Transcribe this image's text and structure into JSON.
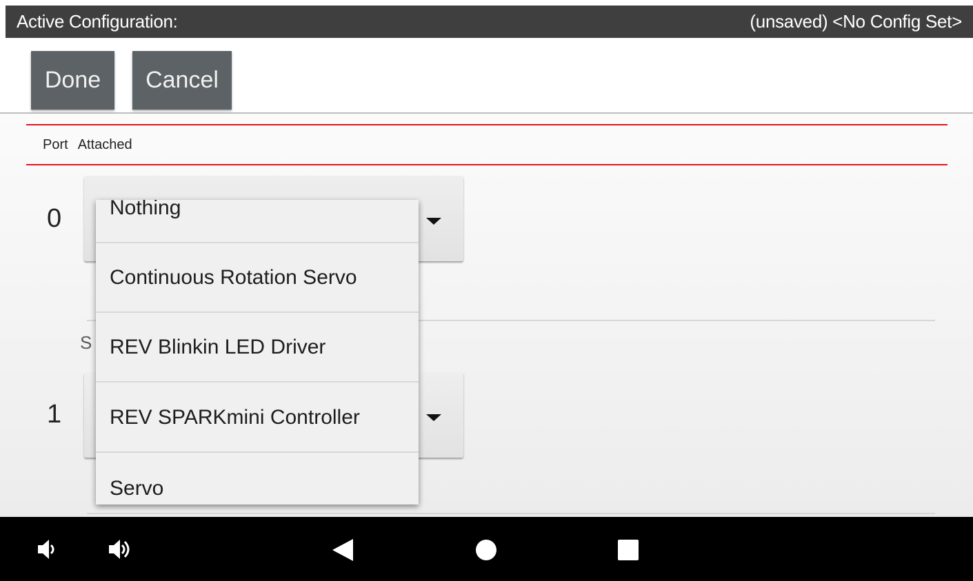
{
  "header": {
    "title": "Active Configuration:",
    "status": "(unsaved) <No Config Set>"
  },
  "toolbar": {
    "done_label": "Done",
    "cancel_label": "Cancel"
  },
  "table": {
    "port_header": "Port",
    "attached_header": "Attached",
    "rows": [
      {
        "port": "0"
      },
      {
        "port": "1"
      }
    ],
    "sub_label_fragment": "S"
  },
  "dropdown": {
    "options": [
      "Nothing",
      "Continuous Rotation Servo",
      "REV Blinkin LED Driver",
      "REV SPARKmini Controller",
      "Servo"
    ]
  },
  "navbar": {
    "icons": [
      "volume-down-icon",
      "volume-up-icon",
      "back-icon",
      "home-icon",
      "recents-icon"
    ]
  },
  "colors": {
    "topbar": "#3f3f3f",
    "button": "#5c6265",
    "accent_line": "#e5121c",
    "navbar": "#000000"
  }
}
